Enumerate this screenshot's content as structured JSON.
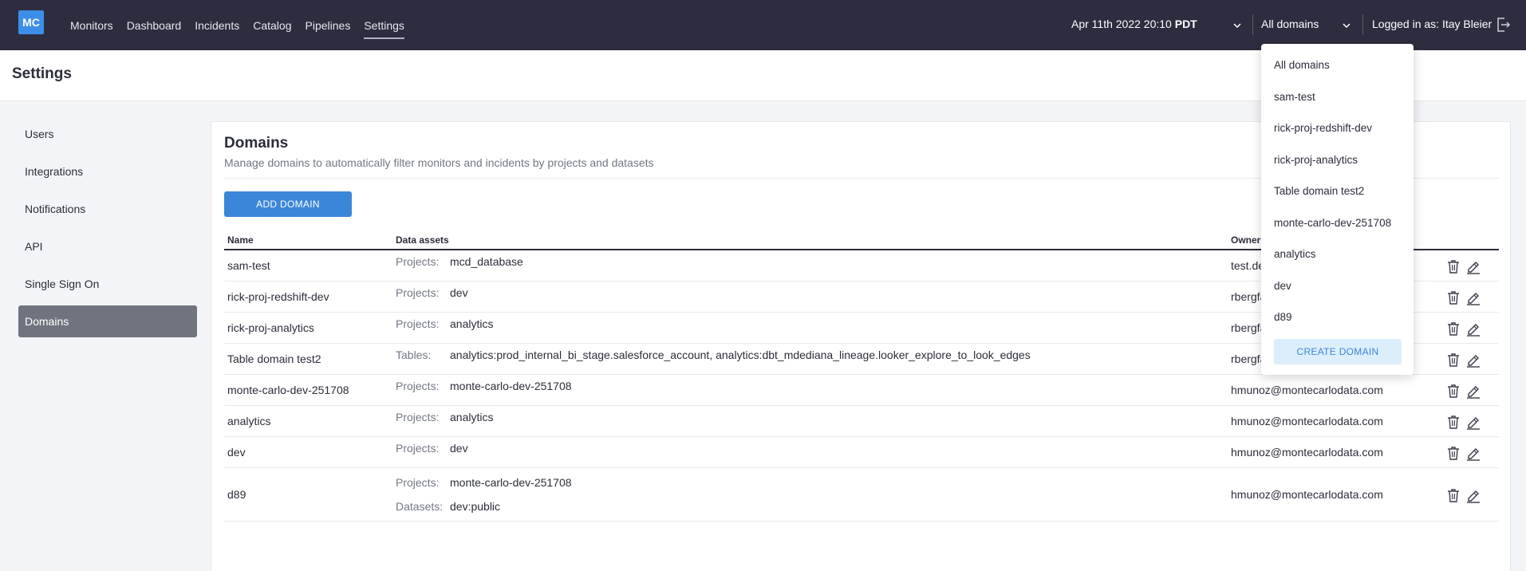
{
  "app": {
    "logo_text": "MC",
    "brand_color": "#3d8ee8",
    "nav_bg": "#2e2d3f"
  },
  "nav": {
    "items": [
      {
        "label": "Monitors"
      },
      {
        "label": "Dashboard"
      },
      {
        "label": "Incidents"
      },
      {
        "label": "Catalog"
      },
      {
        "label": "Pipelines"
      },
      {
        "label": "Settings",
        "active": true
      }
    ]
  },
  "topbar": {
    "date": "Apr 11th 2022 20:10",
    "timezone": "PDT",
    "domain_selected": "All domains",
    "logged_in_label": "Logged in as: Itay Bleier"
  },
  "page": {
    "title": "Settings"
  },
  "sidebar": {
    "items": [
      {
        "label": "Users"
      },
      {
        "label": "Integrations"
      },
      {
        "label": "Notifications"
      },
      {
        "label": "API"
      },
      {
        "label": "Single Sign On"
      },
      {
        "label": "Domains",
        "active": true
      }
    ]
  },
  "domains": {
    "title": "Domains",
    "subtitle": "Manage domains to automatically filter monitors and incidents by projects and datasets",
    "add_button": "ADD DOMAIN",
    "columns": {
      "name": "Name",
      "assets": "Data assets",
      "owners": "Owners"
    },
    "rows": [
      {
        "name": "sam-test",
        "assets": [
          {
            "label": "Projects:",
            "value": "mcd_database"
          }
        ],
        "owner": "test.de"
      },
      {
        "name": "rick-proj-redshift-dev",
        "assets": [
          {
            "label": "Projects:",
            "value": "dev"
          }
        ],
        "owner": "rbergfa"
      },
      {
        "name": "rick-proj-analytics",
        "assets": [
          {
            "label": "Projects:",
            "value": "analytics"
          }
        ],
        "owner": "rbergfa"
      },
      {
        "name": "Table domain test2",
        "assets": [
          {
            "label": "Tables:",
            "value": "analytics:prod_internal_bi_stage.salesforce_account, analytics:dbt_mdediana_lineage.looker_explore_to_look_edges"
          }
        ],
        "owner": "rbergfa"
      },
      {
        "name": "monte-carlo-dev-251708",
        "assets": [
          {
            "label": "Projects:",
            "value": "monte-carlo-dev-251708"
          }
        ],
        "owner": "hmunoz@montecarlodata.com"
      },
      {
        "name": "analytics",
        "assets": [
          {
            "label": "Projects:",
            "value": "analytics"
          }
        ],
        "owner": "hmunoz@montecarlodata.com"
      },
      {
        "name": "dev",
        "assets": [
          {
            "label": "Projects:",
            "value": "dev"
          }
        ],
        "owner": "hmunoz@montecarlodata.com"
      },
      {
        "name": "d89",
        "assets": [
          {
            "label": "Projects:",
            "value": "monte-carlo-dev-251708"
          },
          {
            "label": "Datasets:",
            "value": "dev:public"
          }
        ],
        "owner": "hmunoz@montecarlodata.com"
      }
    ]
  },
  "dropdown": {
    "items": [
      {
        "label": "All domains"
      },
      {
        "label": "sam-test"
      },
      {
        "label": "rick-proj-redshift-dev"
      },
      {
        "label": "rick-proj-analytics"
      },
      {
        "label": "Table domain test2"
      },
      {
        "label": "monte-carlo-dev-251708"
      },
      {
        "label": "analytics"
      },
      {
        "label": "dev"
      },
      {
        "label": "d89"
      }
    ],
    "create_button": "CREATE DOMAIN"
  }
}
